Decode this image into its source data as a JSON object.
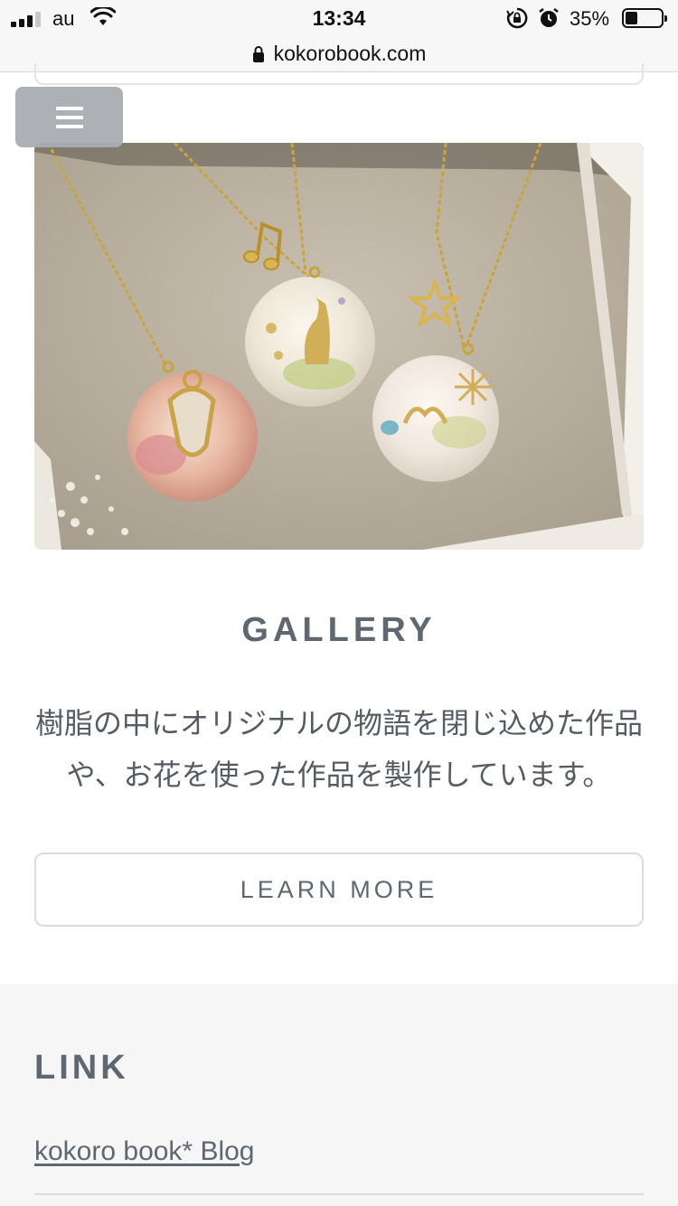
{
  "status_bar": {
    "carrier": "au",
    "time": "13:34",
    "battery_percent": "35%",
    "battery_level": 0.35
  },
  "url_bar": {
    "url": "kokorobook.com"
  },
  "gallery": {
    "title": "GALLERY",
    "description": "樹脂の中にオリジナルの物語を閉じ込めた作品や、お花を使った作品を製作しています。",
    "button_label": "LEARN MORE"
  },
  "footer": {
    "title": "LINK",
    "links": [
      "kokoro book* Blog"
    ]
  },
  "icons": {
    "menu": "hamburger-icon",
    "lock": "lock-icon",
    "wifi": "wifi-icon",
    "rotation_lock": "rotation-lock-icon",
    "alarm": "alarm-icon",
    "battery": "battery-icon"
  },
  "colors": {
    "text_gray": "#5f6771",
    "menu_button_bg": "#a9adb2",
    "footer_bg": "#f6f6f6"
  }
}
